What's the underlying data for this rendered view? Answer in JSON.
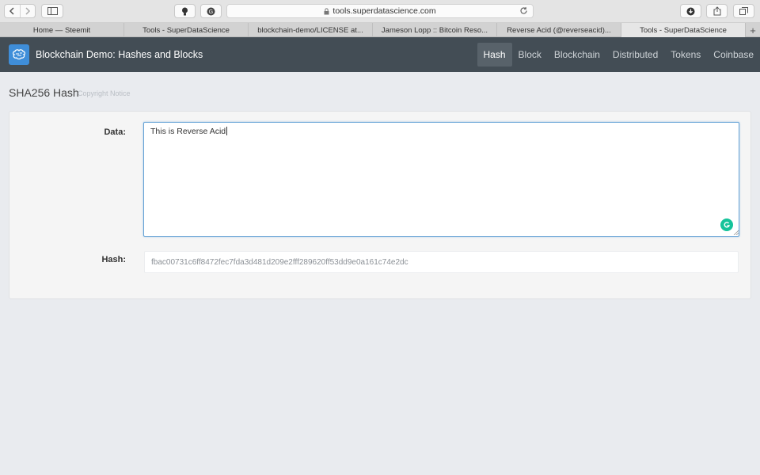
{
  "browser": {
    "url": "tools.superdatascience.com",
    "tabs": [
      {
        "label": "Home — Steemit"
      },
      {
        "label": "Tools - SuperDataScience"
      },
      {
        "label": "blockchain-demo/LICENSE at..."
      },
      {
        "label": "Jameson Lopp :: Bitcoin Reso..."
      },
      {
        "label": "Reverse Acid (@reverseacid)..."
      },
      {
        "label": "Tools - SuperDataScience"
      }
    ],
    "active_tab_index": 5,
    "new_tab_label": "+"
  },
  "navbar": {
    "brand_title": "Blockchain Demo: Hashes and Blocks",
    "links": [
      {
        "label": "Hash",
        "active": true
      },
      {
        "label": "Block",
        "active": false
      },
      {
        "label": "Blockchain",
        "active": false
      },
      {
        "label": "Distributed",
        "active": false
      },
      {
        "label": "Tokens",
        "active": false
      },
      {
        "label": "Coinbase",
        "active": false
      }
    ],
    "colors": {
      "bar": "#434d55",
      "active": "#58626a",
      "logo": "#3f8ed9"
    }
  },
  "page": {
    "title": "SHA256 Hash",
    "copyright_link": "Copyright Notice"
  },
  "form": {
    "data_label": "Data:",
    "data_value": "This is Reverse Acid",
    "hash_label": "Hash:",
    "hash_value": "fbac00731c6ff8472fec7fda3d481d209e2fff289620ff53dd9e0a161c74e2dc"
  }
}
